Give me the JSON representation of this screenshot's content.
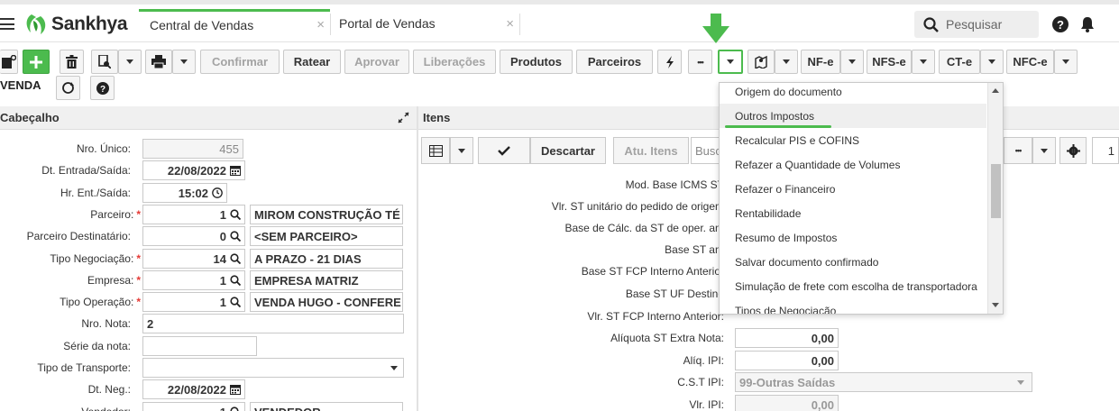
{
  "app": {
    "brand": "Sankhya",
    "tabs": [
      {
        "label": "Central de Vendas",
        "active": true
      },
      {
        "label": "Portal de Vendas",
        "active": false
      }
    ],
    "search_placeholder": "Pesquisar",
    "close_glyph": "×"
  },
  "toolbar": {
    "confirmar": "Confirmar",
    "ratear": "Ratear",
    "aprovar": "Aprovar",
    "liberacoes": "Liberações",
    "produtos": "Produtos",
    "parceiros": "Parceiros",
    "more": "•••",
    "nfe": "NF-e",
    "nfse": "NFS-e",
    "cte": "CT-e",
    "nfce": "NFC-e",
    "mode_label": "VENDA"
  },
  "header_panel": {
    "title": "Cabeçalho",
    "fields": [
      {
        "label": "Nro. Único:",
        "value": "455",
        "required": false
      },
      {
        "label": "Dt. Entrada/Saída:",
        "value": "22/08/2022",
        "required": false
      },
      {
        "label": "Hr. Ent./Saída:",
        "value": "15:02",
        "required": false
      },
      {
        "label": "Parceiro:",
        "value": "1",
        "desc": "MIROM CONSTRUÇÃO TÉ",
        "required": true
      },
      {
        "label": "Parceiro Destinatário:",
        "value": "0",
        "desc": "<SEM PARCEIRO>",
        "required": false
      },
      {
        "label": "Tipo Negociação:",
        "value": "14",
        "desc": "A PRAZO - 21 DIAS",
        "required": true
      },
      {
        "label": "Empresa:",
        "value": "1",
        "desc": "EMPRESA MATRIZ",
        "required": true
      },
      {
        "label": "Tipo Operação:",
        "value": "1",
        "desc": "VENDA HUGO - CONFERE",
        "required": true
      },
      {
        "label": "Nro. Nota:",
        "value": "2",
        "required": false
      },
      {
        "label": "Série da nota:",
        "value": "",
        "required": false
      },
      {
        "label": "Tipo de Transporte:",
        "value": "",
        "required": false
      },
      {
        "label": "Dt. Neg.:",
        "value": "22/08/2022",
        "required": false
      },
      {
        "label": "Vendedor:",
        "value": "1",
        "desc": "VENDEDOR",
        "required": false
      }
    ]
  },
  "items_panel": {
    "title": "Itens",
    "descartar": "Descartar",
    "atu_itens": "Atu. Itens",
    "search_placeholder": "Busc",
    "page_number": "1",
    "fields": [
      {
        "label": "Mod. Base ICMS ST"
      },
      {
        "label": "Vlr. ST unitário do pedido de origem"
      },
      {
        "label": "Base de Cálc. da ST de oper. ant"
      },
      {
        "label": "Base ST ant"
      },
      {
        "label": "Base ST FCP Interno Anterior"
      },
      {
        "label": "Base ST UF Destino"
      },
      {
        "label": "Vlr. ST FCP Interno Anterior:"
      },
      {
        "label": "Alíquota ST Extra Nota:",
        "value": "0,00"
      },
      {
        "label": "Alíq. IPI:",
        "value": "0,00"
      },
      {
        "label": "C.S.T IPI:",
        "value": "99-Outras Saídas"
      },
      {
        "label": "Vlr. IPI:",
        "value": "0,00"
      }
    ]
  },
  "dropdown": {
    "items": [
      "Origem do documento",
      "Outros Impostos",
      "Recalcular PIS e COFINS",
      "Refazer a Quantidade de Volumes",
      "Refazer o Financeiro",
      "Rentabilidade",
      "Resumo de Impostos",
      "Salvar documento confirmado",
      "Simulação de frete com escolha de transportadora",
      "Tipos de Negociação"
    ],
    "highlighted_index": 1
  },
  "colors": {
    "accent": "#4cbb4e",
    "required": "#e53935"
  }
}
